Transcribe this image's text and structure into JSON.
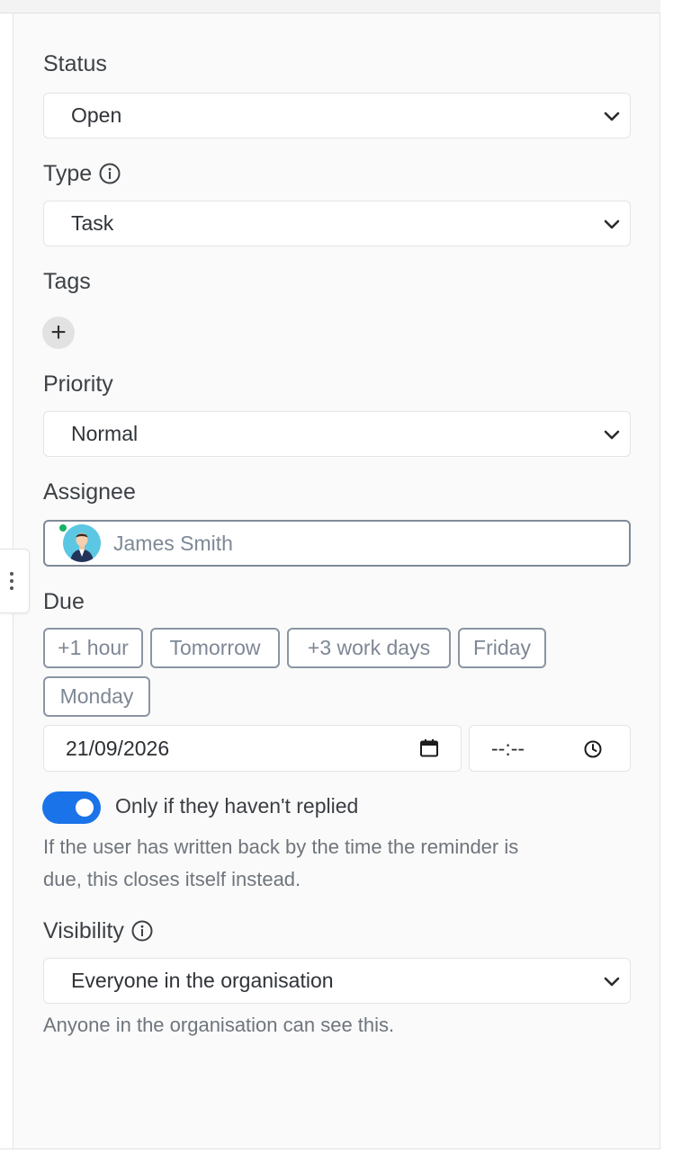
{
  "fields": {
    "status": {
      "label": "Status",
      "value": "Open"
    },
    "type": {
      "label": "Type",
      "value": "Task"
    },
    "tags": {
      "label": "Tags",
      "add_symbol": "+"
    },
    "priority": {
      "label": "Priority",
      "value": "Normal"
    },
    "assignee": {
      "label": "Assignee",
      "name": "James Smith"
    },
    "due": {
      "label": "Due",
      "presets": [
        "+1 hour",
        "Tomorrow",
        "+3 work days",
        "Friday",
        "Monday"
      ],
      "date": "21/09/2026",
      "time": "--:--"
    },
    "reply_toggle": {
      "enabled": true,
      "label": "Only if they haven't replied",
      "help_line1": "If the user has written back by the time the reminder is",
      "help_line2": "due, this closes itself instead."
    },
    "visibility": {
      "label": "Visibility",
      "value": "Everyone in the organisation",
      "help": "Anyone in the organisation can see this."
    }
  },
  "icons": {
    "info": "info-icon",
    "chevron": "chevron-down-icon",
    "calendar": "calendar-icon",
    "clock": "clock-icon",
    "handle": "kebab-vertical-icon"
  },
  "colors": {
    "accent": "#1a73e8",
    "online": "#16b364",
    "chip_border": "#8b95a3"
  }
}
